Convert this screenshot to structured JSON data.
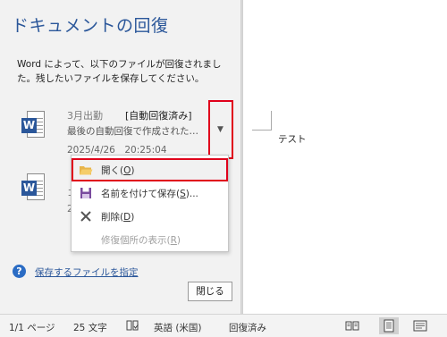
{
  "pane": {
    "title": "ドキュメントの回復",
    "description": "Word によって、以下のファイルが回復されました。残したいファイルを保存してください。",
    "files": [
      {
        "icon": "word-doc-icon",
        "name": "3月出勤",
        "status": "[自動回復済み]",
        "description": "最後の自動回復で作成された…",
        "date": "2025/4/26　20:25:04"
      },
      {
        "icon": "word-doc-icon",
        "fragment_top": "コ",
        "fragment_bottom": "2"
      }
    ],
    "help_link": "保存するファイルを指定",
    "close_button": "閉じる"
  },
  "dropdown_menu": {
    "items": [
      {
        "icon": "open-folder-icon",
        "label_main": "開く(",
        "accesskey": "O",
        "label_end": ")",
        "highlighted": true,
        "enabled": true
      },
      {
        "icon": "save-as-icon",
        "label_main": "名前を付けて保存(",
        "accesskey": "S",
        "label_end": ")...",
        "enabled": true
      },
      {
        "icon": "delete-x-icon",
        "label_main": "削除(",
        "accesskey": "D",
        "label_end": ")",
        "enabled": true
      },
      {
        "icon": "",
        "label_main": "修復個所の表示(",
        "accesskey": "R",
        "label_end": ")",
        "enabled": false
      }
    ]
  },
  "document": {
    "text": "テスト"
  },
  "statusbar": {
    "page": "1/1 ページ",
    "words": "25 文字",
    "language": "英語 (米国)",
    "recovery_status": "回復済み",
    "view_modes": [
      "read-mode-icon",
      "print-layout-icon",
      "web-layout-icon"
    ],
    "active_view": "print-layout-icon"
  },
  "colors": {
    "accent": "#2b579a",
    "highlight_border": "#e0001b"
  }
}
